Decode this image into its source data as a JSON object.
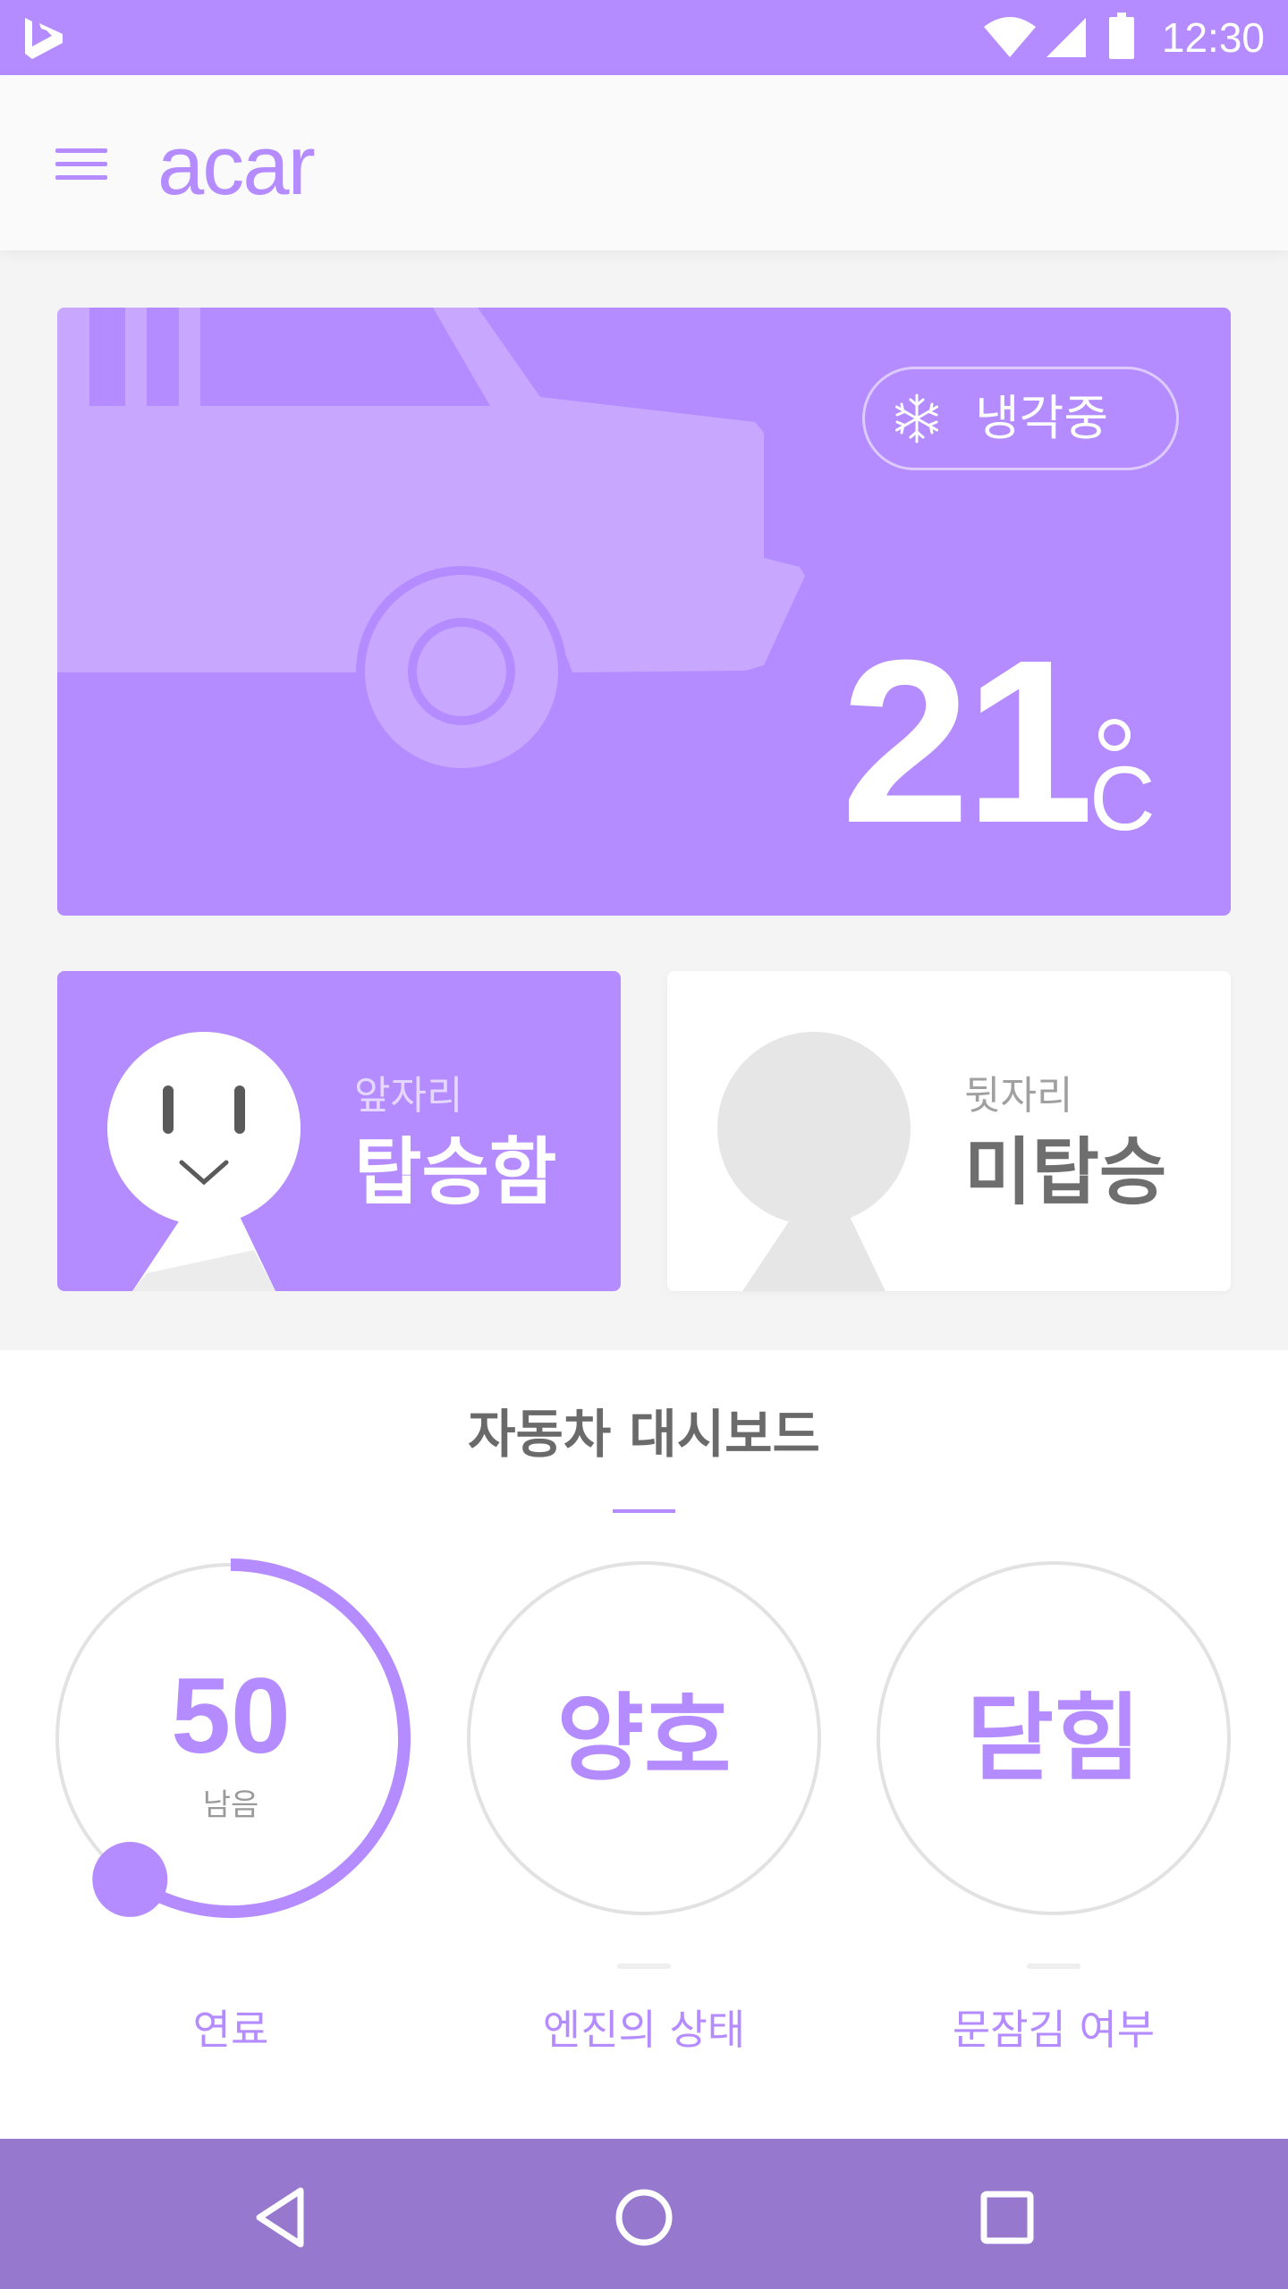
{
  "status_bar": {
    "time": "12:30"
  },
  "app_bar": {
    "logo": "acar"
  },
  "hero": {
    "cooling_label": "냉각중",
    "temperature": "21",
    "unit": "C"
  },
  "seats": {
    "front": {
      "position": "앞자리",
      "status": "탑승함"
    },
    "rear": {
      "position": "뒷자리",
      "status": "미탑승"
    }
  },
  "dashboard": {
    "title": "자동차 대시보드",
    "fuel": {
      "value": "50",
      "sub": "남음",
      "label": "연료",
      "fraction": 0.5
    },
    "engine": {
      "value": "양호",
      "label": "엔진의 상태"
    },
    "door": {
      "value": "닫힘",
      "label": "문잠김 여부"
    }
  },
  "colors": {
    "accent": "#b48cff",
    "nav": "#9678cf",
    "card_white": "#ffffff"
  }
}
